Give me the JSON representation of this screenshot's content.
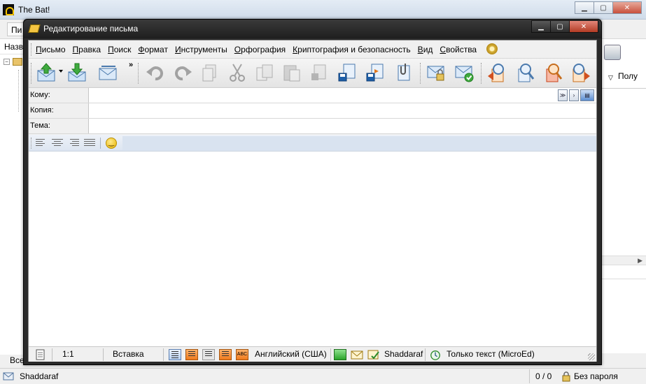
{
  "main_window": {
    "title": "The Bat!",
    "menu_fragment": "Пи",
    "column_fragment": "Назв",
    "right_fragment": "Полу",
    "bottom_fragment": "Все",
    "status": {
      "account": "Shaddaraf",
      "count": "0 / 0",
      "password": "Без пароля"
    }
  },
  "editor": {
    "title": "Редактирование письма",
    "menu": [
      "Письмо",
      "Правка",
      "Поиск",
      "Формат",
      "Инструменты",
      "Орфография",
      "Криптография и безопасность",
      "Вид",
      "Свойства"
    ],
    "toolbar": {
      "send": "send-icon",
      "queue": "queue-icon",
      "save_draft": "draft-icon",
      "undo": "undo-icon",
      "redo": "redo-icon",
      "more": "»"
    },
    "fields": {
      "to_label": "Кому:",
      "cc_label": "Копия:",
      "subject_label": "Тема:",
      "to_value": "",
      "cc_value": "",
      "subject_value": ""
    },
    "status": {
      "ratio": "1:1",
      "mode": "Вставка",
      "language": "Английский (США)",
      "account": "Shaddaraf",
      "editor_mode": "Только текст (MicroEd)"
    }
  },
  "colors": {
    "editor_title_bg": "#1f1f1f",
    "close_button": "#c8503c",
    "format_bar": "#dce5f1",
    "accent_orange": "#ef7a1c"
  }
}
